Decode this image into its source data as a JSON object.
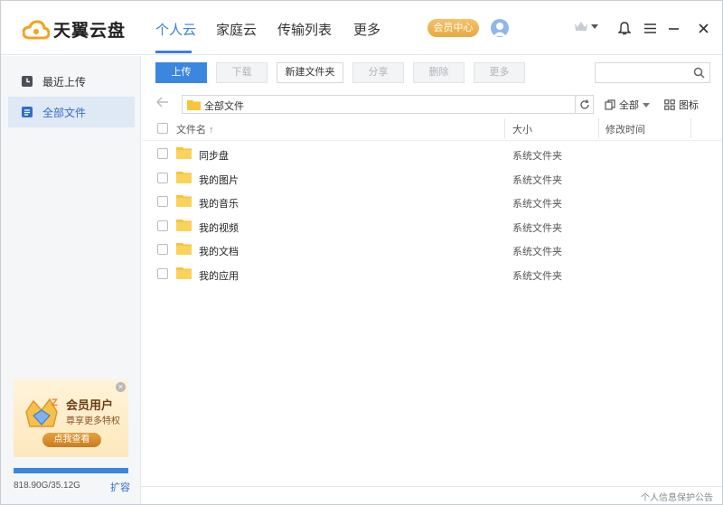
{
  "app": {
    "logo_text": "天翼云盘",
    "brand_color": "#3b86de"
  },
  "nav": {
    "tabs": [
      {
        "label": "个人云",
        "active": true
      },
      {
        "label": "家庭云",
        "active": false
      },
      {
        "label": "传输列表",
        "active": false
      },
      {
        "label": "更多",
        "active": false
      }
    ],
    "vip_button": "会员中心"
  },
  "window_controls": [
    "crown-icon",
    "bell-icon",
    "menu-icon",
    "minimize-icon",
    "maximize-icon",
    "close-icon"
  ],
  "sidebar": {
    "items": [
      {
        "label": "最近上传",
        "icon": "clock-icon",
        "active": false
      },
      {
        "label": "全部文件",
        "icon": "files-icon",
        "active": true
      }
    ],
    "promo": {
      "title": "会员用户",
      "subtitle": "尊享更多特权",
      "button": "点我查看"
    },
    "storage": {
      "text": "818.90G/35.12G",
      "expand": "扩容",
      "used_fraction": 1.0
    }
  },
  "toolbar": {
    "buttons": [
      {
        "label": "上传",
        "state": "primary"
      },
      {
        "label": "下载",
        "state": "disabled"
      },
      {
        "label": "新建文件夹",
        "state": "normal"
      },
      {
        "label": "分享",
        "state": "disabled"
      },
      {
        "label": "删除",
        "state": "disabled"
      },
      {
        "label": "更多",
        "state": "disabled"
      }
    ],
    "search_placeholder": ""
  },
  "path": {
    "current": "全部文件"
  },
  "filter": {
    "label": "全部"
  },
  "view": {
    "label": "图标"
  },
  "table": {
    "columns": {
      "name": "文件名",
      "sort_arrow": "↑",
      "size": "大小",
      "modified": "修改时间"
    },
    "rows": [
      {
        "name": "同步盘",
        "type": "系统文件夹"
      },
      {
        "name": "我的图片",
        "type": "系统文件夹"
      },
      {
        "name": "我的音乐",
        "type": "系统文件夹"
      },
      {
        "name": "我的视频",
        "type": "系统文件夹"
      },
      {
        "name": "我的文档",
        "type": "系统文件夹"
      },
      {
        "name": "我的应用",
        "type": "系统文件夹"
      }
    ]
  },
  "footer": {
    "privacy": "个人信息保护公告"
  }
}
